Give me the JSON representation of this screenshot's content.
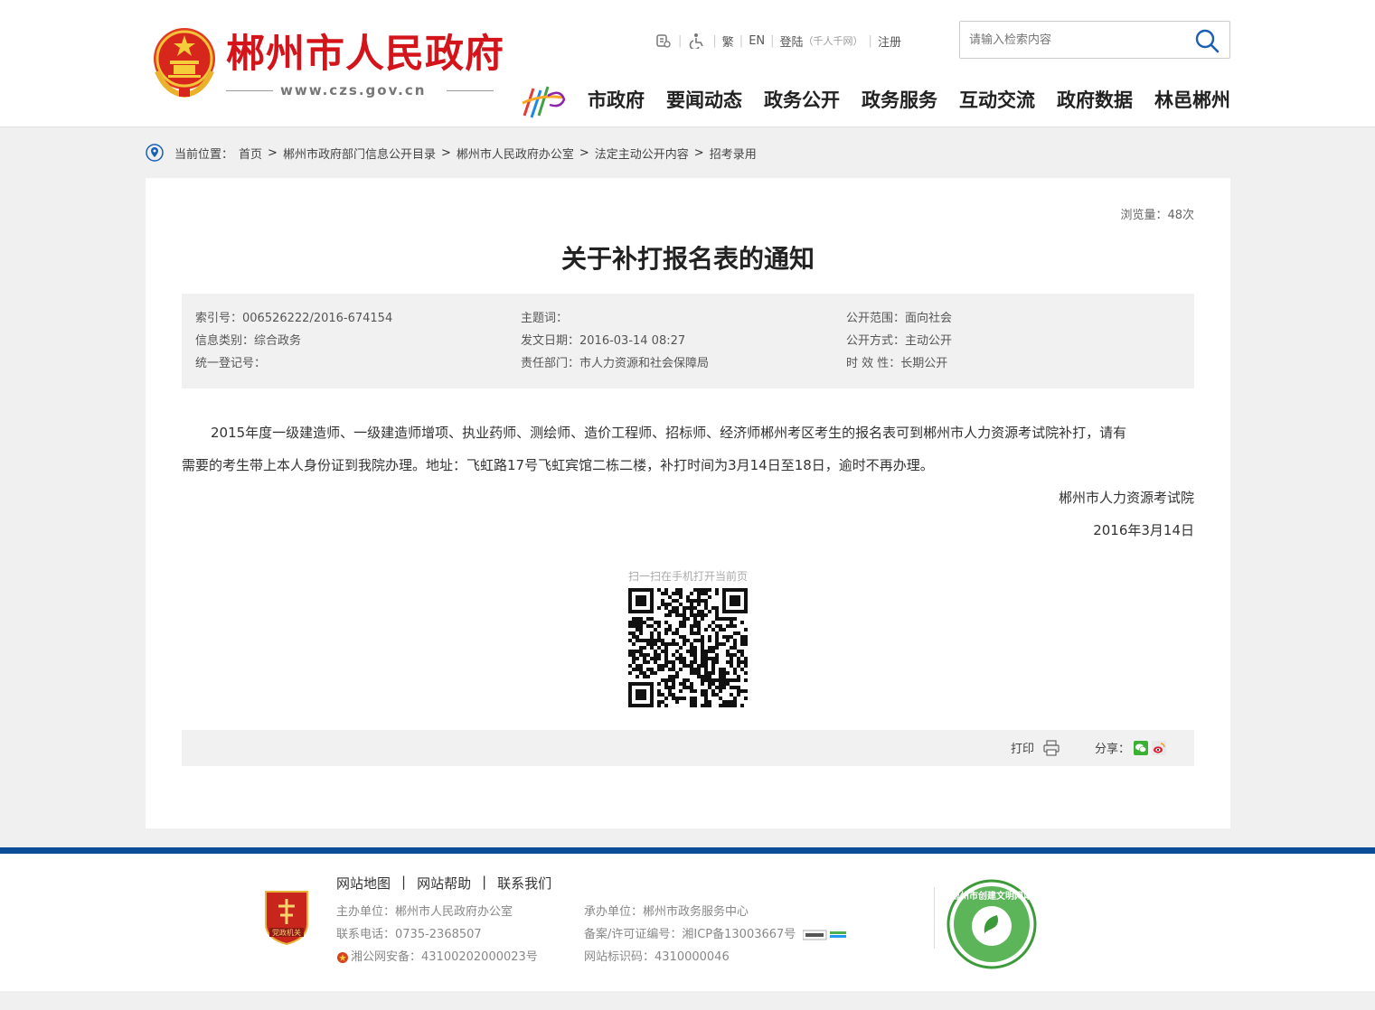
{
  "header": {
    "site_name": "郴州市人民政府",
    "site_url": "www.czs.gov.cn",
    "toplinks": {
      "traditional": "繁",
      "english": "EN",
      "login": "登陆",
      "login_note": "（千人千网）",
      "register": "注册"
    },
    "search_placeholder": "请输入检索内容",
    "nav": [
      "市政府",
      "要闻动态",
      "政务公开",
      "政务服务",
      "互动交流",
      "政府数据",
      "林邑郴州"
    ]
  },
  "breadcrumb": {
    "label": "当前位置：",
    "items": [
      "首页",
      "郴州市政府部门信息公开目录",
      "郴州市人民政府办公室",
      "法定主动公开内容",
      "招考录用"
    ]
  },
  "article": {
    "views": "浏览量：48次",
    "title": "关于补打报名表的通知",
    "meta": {
      "index_no": "索引号：006526222/2016-674154",
      "topic": "主题词：",
      "scope": "公开范围：面向社会",
      "category": "信息类别：综合政务",
      "date": "发文日期：2016-03-14 08:27",
      "method": "公开方式：主动公开",
      "reg_no": "统一登记号：",
      "dept": "责任部门：市人力资源和社会保障局",
      "validity": "时 效 性：长期公开"
    },
    "body_line1": "2015年度一级建造师、一级建造师增项、执业药师、测绘师、造价工程师、招标师、经济师郴州考区考生的报名表可到郴州市人力资源考试院补打，请有",
    "body_line2": "需要的考生带上本人身份证到我院办理。地址：飞虹路17号飞虹宾馆二栋二楼，补打时间为3月14日至18日，逾时不再办理。",
    "signature": "郴州市人力资源考试院",
    "sign_date": "2016年3月14日",
    "qr_caption": "扫一扫在手机打开当前页",
    "print_label": "打印",
    "share_label": "分享："
  },
  "footer": {
    "links": [
      "网站地图",
      "网站帮助",
      "联系我们"
    ],
    "host": "主办单位：郴州市人民政府办公室",
    "phone": "联系电话：0735-2368507",
    "police": "湘公网安备：43100202000023号",
    "organizer": "承办单位：郴州市政务服务中心",
    "icp": "备案/许可证编号：湘ICP备13003667号",
    "site_id": "网站标识码：4310000046",
    "party_badge_text": "党政机关",
    "civ_badge_text": "郴州市创建文明网站"
  },
  "colors": {
    "brand_red": "#d4141b",
    "footer_blue": "#0c4d98",
    "meta_bg": "#f1f1f1",
    "page_bg": "#f0f0f0"
  },
  "icons": [
    "emblem-icon",
    "barrier-free-icon",
    "accessibility-icon",
    "search-icon",
    "location-pin-icon",
    "print-icon",
    "wechat-icon",
    "weibo-icon",
    "qr-code",
    "police-icon"
  ]
}
